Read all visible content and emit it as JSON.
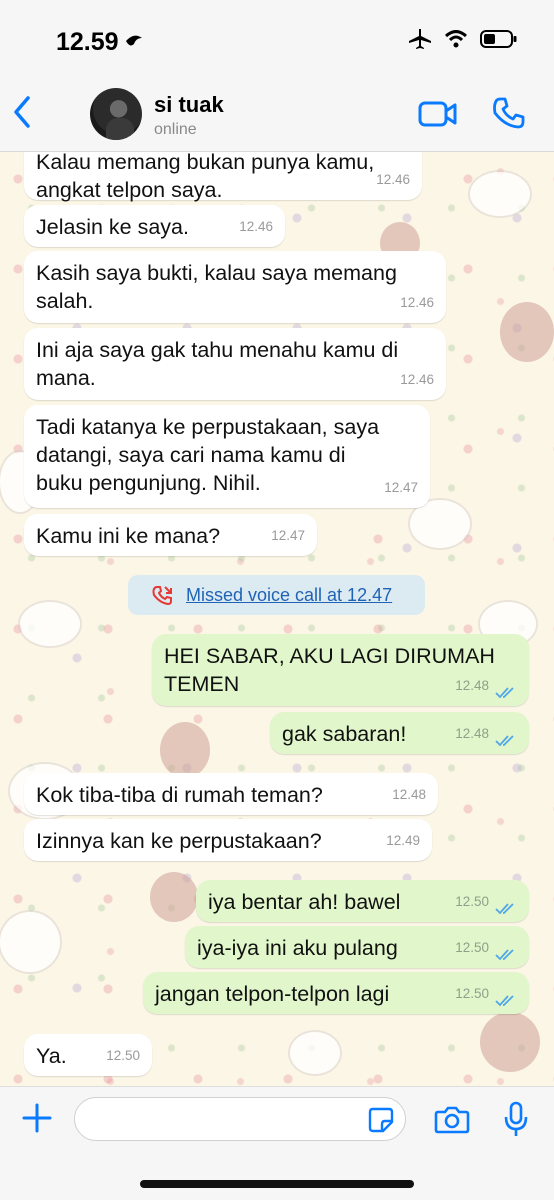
{
  "status_bar": {
    "time": "12.59",
    "icons": [
      "airplane-mode-icon",
      "wifi-icon",
      "battery-icon"
    ]
  },
  "header": {
    "contact_name": "si tuak",
    "contact_status": "online",
    "accent_color": "#0a7aff"
  },
  "messages": [
    {
      "direction": "in",
      "lines": [
        "Kalau memang bukan punya kamu,",
        "angkat telpon saya."
      ],
      "time": "12.46"
    },
    {
      "direction": "in",
      "lines": [
        "Jelasin ke saya."
      ],
      "time": "12.46"
    },
    {
      "direction": "in",
      "lines": [
        "Kasih saya bukti, kalau saya memang",
        "salah."
      ],
      "time": "12.46"
    },
    {
      "direction": "in",
      "lines": [
        "Ini aja saya gak tahu menahu kamu di",
        "mana."
      ],
      "time": "12.46"
    },
    {
      "direction": "in",
      "lines": [
        "Tadi katanya ke perpustakaan, saya",
        "datangi, saya cari nama kamu di",
        "buku pengunjung. Nihil."
      ],
      "time": "12.47"
    },
    {
      "direction": "in",
      "lines": [
        "Kamu ini ke mana?"
      ],
      "time": "12.47"
    },
    {
      "direction": "out",
      "lines": [
        "HEI SABAR, AKU LAGI DIRUMAH",
        "TEMEN"
      ],
      "time": "12.48"
    },
    {
      "direction": "out",
      "lines": [
        "gak sabaran!"
      ],
      "time": "12.48"
    },
    {
      "direction": "in",
      "lines": [
        "Kok tiba-tiba di rumah teman?"
      ],
      "time": "12.48"
    },
    {
      "direction": "in",
      "lines": [
        "Izinnya kan ke perpustakaan?"
      ],
      "time": "12.49"
    },
    {
      "direction": "out",
      "lines": [
        "iya bentar ah! bawel"
      ],
      "time": "12.50"
    },
    {
      "direction": "out",
      "lines": [
        "iya-iya ini aku pulang"
      ],
      "time": "12.50"
    },
    {
      "direction": "out",
      "lines": [
        "jangan telpon-telpon lagi"
      ],
      "time": "12.50"
    },
    {
      "direction": "in",
      "lines": [
        "Ya."
      ],
      "time": "12.50"
    }
  ],
  "missed_call": {
    "label": "Missed voice call at 12.47",
    "icon": "missed-call-icon"
  },
  "input_bar": {
    "placeholder": "",
    "icons": [
      "plus-icon",
      "sticker-icon",
      "camera-icon",
      "microphone-icon"
    ]
  },
  "colors": {
    "incoming_bubble": "#ffffff",
    "outgoing_bubble": "#e1f7cb",
    "read_ticks": "#4fa6e8",
    "missed_call_red": "#e53935",
    "link_blue": "#1f63b7"
  }
}
